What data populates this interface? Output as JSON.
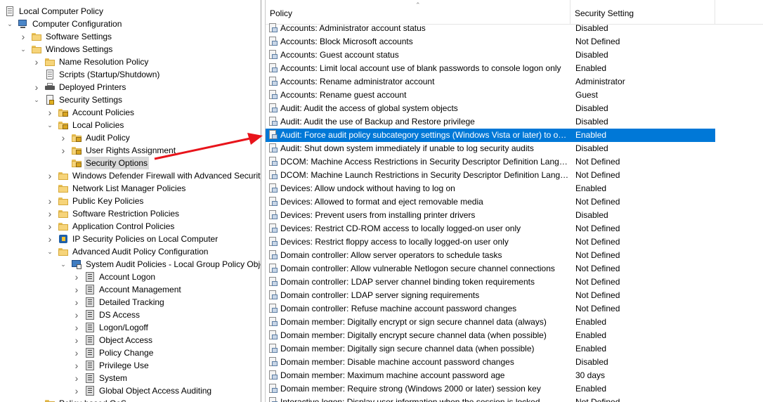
{
  "tree": [
    {
      "label": "Local Computer Policy",
      "icon": "policy-doc-icon",
      "expander": "none",
      "level": 0
    },
    {
      "label": "Computer Configuration",
      "icon": "computer-icon",
      "expander": "expanded",
      "level": 0
    },
    {
      "label": "Software Settings",
      "icon": "folder-icon",
      "expander": "collapsed",
      "level": 1
    },
    {
      "label": "Windows Settings",
      "icon": "folder-icon",
      "expander": "expanded",
      "level": 1
    },
    {
      "label": "Name Resolution Policy",
      "icon": "folder-icon",
      "expander": "collapsed",
      "level": 2
    },
    {
      "label": "Scripts (Startup/Shutdown)",
      "icon": "script-icon",
      "expander": "none",
      "level": 2
    },
    {
      "label": "Deployed Printers",
      "icon": "printer-icon",
      "expander": "collapsed",
      "level": 2
    },
    {
      "label": "Security Settings",
      "icon": "security-settings-icon",
      "expander": "expanded",
      "level": 2
    },
    {
      "label": "Account Policies",
      "icon": "lock-folder-icon",
      "expander": "collapsed",
      "level": 3
    },
    {
      "label": "Local Policies",
      "icon": "lock-folder-icon",
      "expander": "expanded",
      "level": 3
    },
    {
      "label": "Audit Policy",
      "icon": "lock-folder-icon",
      "expander": "collapsed",
      "level": 4
    },
    {
      "label": "User Rights Assignment",
      "icon": "lock-folder-icon",
      "expander": "collapsed",
      "level": 4
    },
    {
      "label": "Security Options",
      "icon": "lock-folder-icon",
      "expander": "none",
      "level": 4,
      "selected": true
    },
    {
      "label": "Windows Defender Firewall with Advanced Security",
      "icon": "folder-icon",
      "expander": "collapsed",
      "level": 3
    },
    {
      "label": "Network List Manager Policies",
      "icon": "folder-icon",
      "expander": "none",
      "level": 3
    },
    {
      "label": "Public Key Policies",
      "icon": "folder-icon",
      "expander": "collapsed",
      "level": 3
    },
    {
      "label": "Software Restriction Policies",
      "icon": "folder-icon",
      "expander": "collapsed",
      "level": 3
    },
    {
      "label": "Application Control Policies",
      "icon": "folder-icon",
      "expander": "collapsed",
      "level": 3
    },
    {
      "label": "IP Security Policies on Local Computer",
      "icon": "ip-security-icon",
      "expander": "collapsed",
      "level": 3
    },
    {
      "label": "Advanced Audit Policy Configuration",
      "icon": "folder-icon",
      "expander": "expanded",
      "level": 3
    },
    {
      "label": "System Audit Policies - Local Group Policy Object",
      "icon": "system-audit-icon",
      "expander": "expanded",
      "level": 4
    },
    {
      "label": "Account Logon",
      "icon": "audit-category-icon",
      "expander": "collapsed",
      "level": 5
    },
    {
      "label": "Account Management",
      "icon": "audit-category-icon",
      "expander": "collapsed",
      "level": 5
    },
    {
      "label": "Detailed Tracking",
      "icon": "audit-category-icon",
      "expander": "collapsed",
      "level": 5
    },
    {
      "label": "DS Access",
      "icon": "audit-category-icon",
      "expander": "collapsed",
      "level": 5
    },
    {
      "label": "Logon/Logoff",
      "icon": "audit-category-icon",
      "expander": "collapsed",
      "level": 5
    },
    {
      "label": "Object Access",
      "icon": "audit-category-icon",
      "expander": "collapsed",
      "level": 5
    },
    {
      "label": "Policy Change",
      "icon": "audit-category-icon",
      "expander": "collapsed",
      "level": 5
    },
    {
      "label": "Privilege Use",
      "icon": "audit-category-icon",
      "expander": "collapsed",
      "level": 5
    },
    {
      "label": "System",
      "icon": "audit-category-icon",
      "expander": "collapsed",
      "level": 5
    },
    {
      "label": "Global Object Access Auditing",
      "icon": "audit-category-icon",
      "expander": "collapsed",
      "level": 5
    },
    {
      "label": "Policy-based QoS",
      "icon": "folder-icon",
      "expander": "collapsed",
      "level": 2
    }
  ],
  "list": {
    "columns": {
      "policy": "Policy",
      "setting": "Security Setting"
    },
    "rows": [
      {
        "policy": "Accounts: Administrator account status",
        "setting": "Disabled"
      },
      {
        "policy": "Accounts: Block Microsoft accounts",
        "setting": "Not Defined"
      },
      {
        "policy": "Accounts: Guest account status",
        "setting": "Disabled"
      },
      {
        "policy": "Accounts: Limit local account use of blank passwords to console logon only",
        "setting": "Enabled"
      },
      {
        "policy": "Accounts: Rename administrator account",
        "setting": "Administrator"
      },
      {
        "policy": "Accounts: Rename guest account",
        "setting": "Guest"
      },
      {
        "policy": "Audit: Audit the access of global system objects",
        "setting": "Disabled"
      },
      {
        "policy": "Audit: Audit the use of Backup and Restore privilege",
        "setting": "Disabled"
      },
      {
        "policy": "Audit: Force audit policy subcategory settings (Windows Vista or later) to override audit policy category settings",
        "setting": "Enabled",
        "selected": true
      },
      {
        "policy": "Audit: Shut down system immediately if unable to log security audits",
        "setting": "Disabled"
      },
      {
        "policy": "DCOM: Machine Access Restrictions in Security Descriptor Definition Language (SDDL) syntax",
        "setting": "Not Defined"
      },
      {
        "policy": "DCOM: Machine Launch Restrictions in Security Descriptor Definition Language (SDDL) syntax",
        "setting": "Not Defined"
      },
      {
        "policy": "Devices: Allow undock without having to log on",
        "setting": "Enabled"
      },
      {
        "policy": "Devices: Allowed to format and eject removable media",
        "setting": "Not Defined"
      },
      {
        "policy": "Devices: Prevent users from installing printer drivers",
        "setting": "Disabled"
      },
      {
        "policy": "Devices: Restrict CD-ROM access to locally logged-on user only",
        "setting": "Not Defined"
      },
      {
        "policy": "Devices: Restrict floppy access to locally logged-on user only",
        "setting": "Not Defined"
      },
      {
        "policy": "Domain controller: Allow server operators to schedule tasks",
        "setting": "Not Defined"
      },
      {
        "policy": "Domain controller: Allow vulnerable Netlogon secure channel connections",
        "setting": "Not Defined"
      },
      {
        "policy": "Domain controller: LDAP server channel binding token requirements",
        "setting": "Not Defined"
      },
      {
        "policy": "Domain controller: LDAP server signing requirements",
        "setting": "Not Defined"
      },
      {
        "policy": "Domain controller: Refuse machine account password changes",
        "setting": "Not Defined"
      },
      {
        "policy": "Domain member: Digitally encrypt or sign secure channel data (always)",
        "setting": "Enabled"
      },
      {
        "policy": "Domain member: Digitally encrypt secure channel data (when possible)",
        "setting": "Enabled"
      },
      {
        "policy": "Domain member: Digitally sign secure channel data (when possible)",
        "setting": "Enabled"
      },
      {
        "policy": "Domain member: Disable machine account password changes",
        "setting": "Disabled"
      },
      {
        "policy": "Domain member: Maximum machine account password age",
        "setting": "30 days"
      },
      {
        "policy": "Domain member: Require strong (Windows 2000 or later) session key",
        "setting": "Enabled"
      },
      {
        "policy": "Interactive logon: Display user information when the session is locked",
        "setting": "Not Defined"
      }
    ]
  },
  "annotation": {
    "arrow_color": "#e8141b"
  },
  "colors": {
    "selection": "#0078d7",
    "tree_selection": "#d9d9d9"
  }
}
